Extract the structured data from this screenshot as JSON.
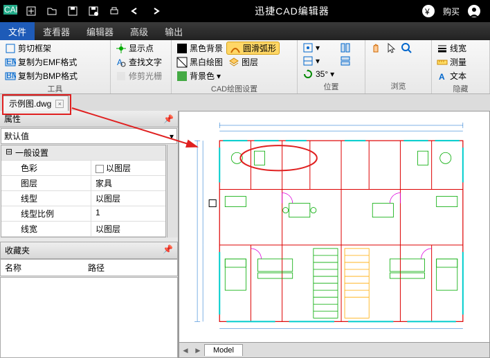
{
  "title": "迅捷CAD编辑器",
  "titlebar": {
    "buy": "购买"
  },
  "menu": {
    "file": "文件",
    "viewer": "查看器",
    "editor": "编辑器",
    "advanced": "高级",
    "output": "输出"
  },
  "ribbon": {
    "tools": {
      "label": "工具",
      "crop": "剪切框架",
      "emf": "复制为EMF格式",
      "bmp": "复制为BMP格式",
      "showpt": "显示点",
      "findtxt": "查找文字",
      "aperture": "修剪光栅"
    },
    "cad": {
      "label": "CAD绘图设置",
      "blackbg": "黑色背景",
      "bwdraw": "黑白绘图",
      "bgcolor": "背景色",
      "smootharc": "圆滑弧形",
      "layer": "图层"
    },
    "pos": {
      "label": "位置",
      "deg": "35°"
    },
    "browse": {
      "label": "浏览"
    },
    "hide": {
      "label": "隐藏",
      "linew": "线宽",
      "measure": "测量",
      "text": "文本"
    }
  },
  "fileTab": {
    "name": "示例图.dwg"
  },
  "propPanel": {
    "title": "属性",
    "default": "默认值",
    "group": "一般设置",
    "rows": [
      {
        "k": "色彩",
        "v": "以图层",
        "chk": true
      },
      {
        "k": "图层",
        "v": "家具"
      },
      {
        "k": "线型",
        "v": "以图层"
      },
      {
        "k": "线型比例",
        "v": "1"
      },
      {
        "k": "线宽",
        "v": "以图层"
      }
    ]
  },
  "fav": {
    "title": "收藏夹",
    "col1": "名称",
    "col2": "路径"
  },
  "bottomTab": "Model"
}
